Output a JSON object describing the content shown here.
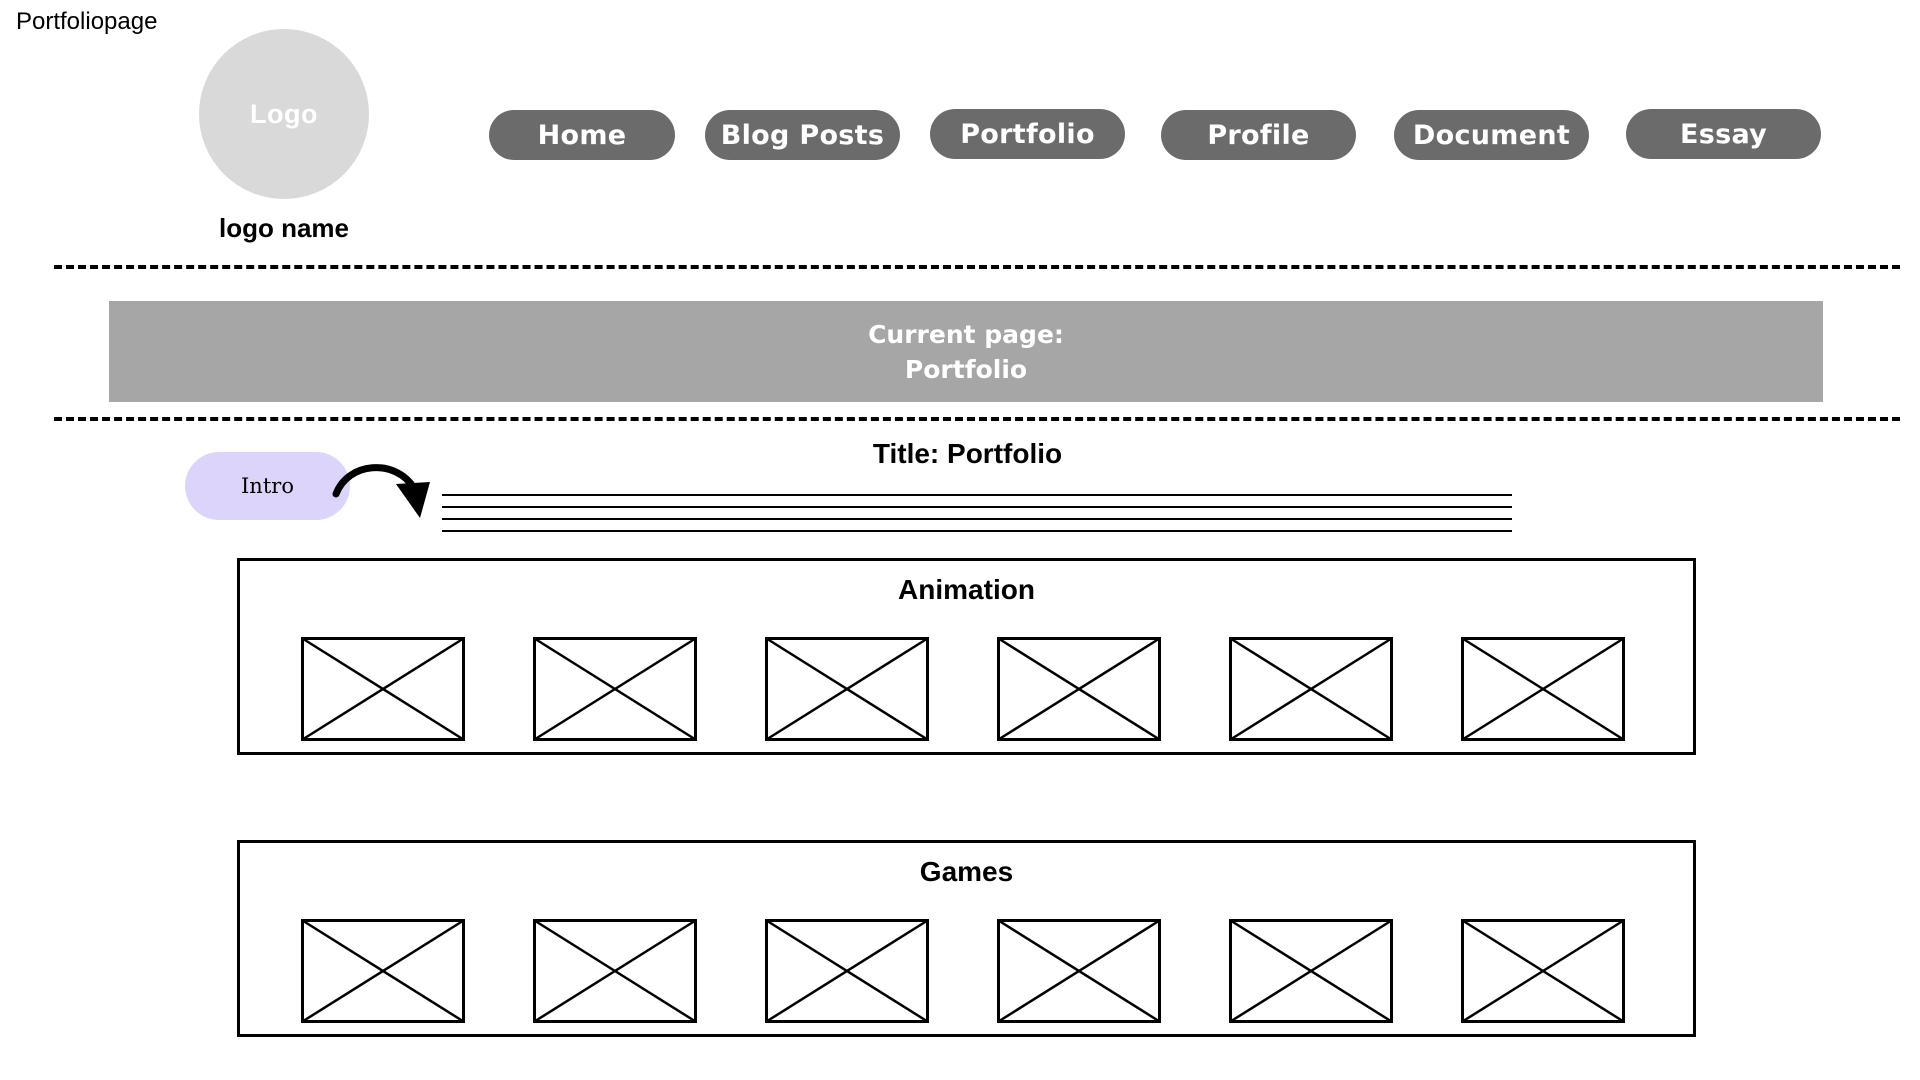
{
  "page_label": "Portfoliopage",
  "logo": {
    "text": "Logo",
    "name": "logo name"
  },
  "nav": {
    "items": [
      {
        "label": "Home"
      },
      {
        "label": "Blog Posts"
      },
      {
        "label": "Portfolio"
      },
      {
        "label": "Profile"
      },
      {
        "label": "Document"
      },
      {
        "label": "Essay"
      }
    ]
  },
  "banner": {
    "line1": "Current page:",
    "line2": "Portfolio"
  },
  "title": "Title: Portfolio",
  "intro": {
    "label": "Intro"
  },
  "sections": [
    {
      "title": "Animation",
      "placeholder_count": 6
    },
    {
      "title": "Games",
      "placeholder_count": 6
    }
  ],
  "colors": {
    "nav_button": "#6b6b6b",
    "banner": "#a6a6a6",
    "logo_circle": "#d9d9d9",
    "intro_pill": "#dcd4fb"
  }
}
